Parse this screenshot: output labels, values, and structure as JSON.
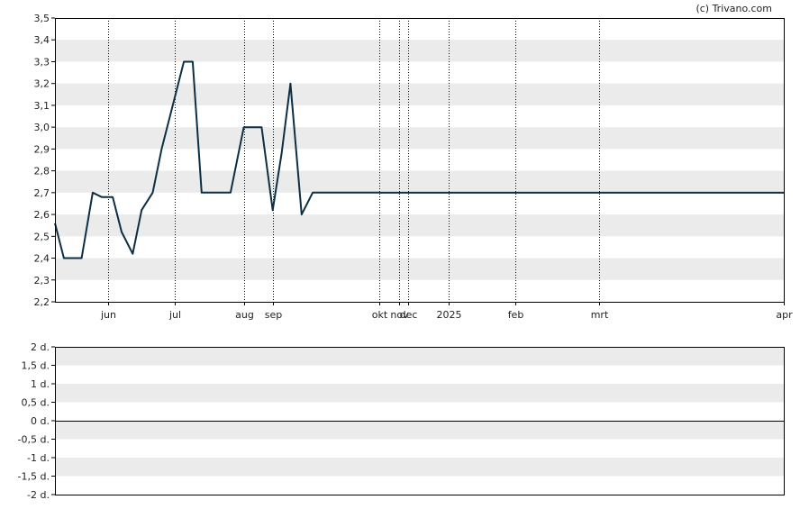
{
  "credit": "(c) Trivano.com",
  "colors": {
    "line": "#0d2f45",
    "band": "#ebebeb",
    "grid": "#000000",
    "axis": "#000000"
  },
  "chart_data": [
    {
      "type": "line",
      "title": "",
      "xlabel": "",
      "ylabel": "",
      "ylim": [
        2.2,
        3.5
      ],
      "y_ticks": [
        "3,5",
        "3,4",
        "3,3",
        "3,2",
        "3,1",
        "3,0",
        "2,9",
        "2,8",
        "2,7",
        "2,6",
        "2,5",
        "2,4",
        "2,3",
        "2,2"
      ],
      "x_domain": [
        "2024-05-08",
        "2025-04-01"
      ],
      "x_ticks": [
        {
          "label": "jun",
          "date": "2024-06-01"
        },
        {
          "label": "jul",
          "date": "2024-07-01"
        },
        {
          "label": "aug",
          "date": "2024-08-01"
        },
        {
          "label": "sep",
          "date": "2024-08-14"
        },
        {
          "label": "okt",
          "date": "2024-10-01"
        },
        {
          "label": "nov",
          "date": "2024-10-10"
        },
        {
          "label": "dec",
          "date": "2024-10-14"
        },
        {
          "label": "2025",
          "date": "2024-11-01"
        },
        {
          "label": "feb",
          "date": "2024-12-01"
        },
        {
          "label": "mrt",
          "date": "2025-01-08"
        },
        {
          "label": "apr",
          "date": "2025-04-01"
        }
      ],
      "grid": true,
      "series": [
        {
          "x": [
            "2024-05-08",
            "2024-05-12",
            "2024-05-20",
            "2024-05-25",
            "2024-05-29",
            "2024-06-03",
            "2024-06-07",
            "2024-06-12",
            "2024-06-16",
            "2024-06-21",
            "2024-06-25",
            "2024-07-05",
            "2024-07-09",
            "2024-07-13",
            "2024-07-17",
            "2024-07-26",
            "2024-08-01",
            "2024-08-05",
            "2024-08-09",
            "2024-08-14",
            "2024-08-18",
            "2024-08-22",
            "2024-08-27",
            "2024-09-01",
            "2024-09-05",
            "2024-10-01"
          ],
          "y": [
            2.56,
            2.4,
            2.4,
            2.7,
            2.68,
            2.68,
            2.52,
            2.42,
            2.62,
            2.7,
            2.9,
            3.3,
            3.3,
            2.7,
            2.7,
            2.7,
            3.0,
            3.0,
            3.0,
            2.62,
            2.88,
            3.2,
            2.6,
            2.7,
            2.7,
            2.7
          ]
        }
      ]
    },
    {
      "type": "line",
      "title": "",
      "ylim": [
        -2,
        2
      ],
      "y_ticks": [
        "2 d.",
        "1,5 d.",
        "1 d.",
        "0,5 d.",
        "0 d.",
        "-0,5 d.",
        "-1 d.",
        "-1,5 d.",
        "-2 d."
      ],
      "grid": true,
      "series": [
        {
          "y": [
            0,
            0
          ]
        }
      ]
    }
  ]
}
